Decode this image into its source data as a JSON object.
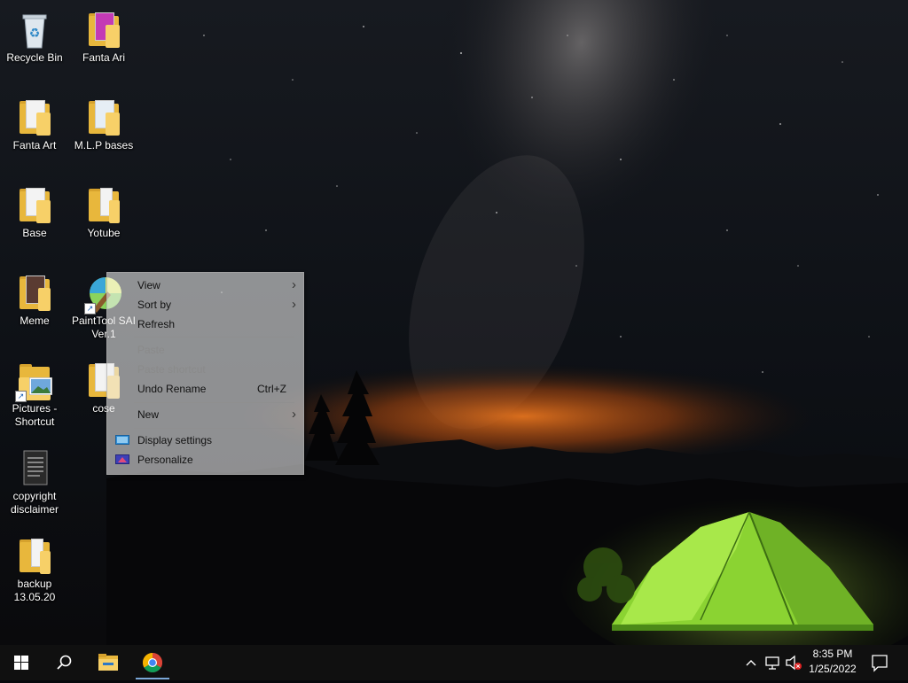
{
  "desktop": {
    "icons": [
      {
        "label": "Recycle Bin"
      },
      {
        "label": "Fanta Ari"
      },
      {
        "label": "Fanta Art"
      },
      {
        "label": "M.L.P bases"
      },
      {
        "label": "Base"
      },
      {
        "label": "Yotube"
      },
      {
        "label": "Meme"
      },
      {
        "label": "PaintTool SAI Ver.1"
      },
      {
        "label": "Pictures - Shortcut"
      },
      {
        "label": "cose"
      },
      {
        "label": "copyright disclaimer"
      },
      {
        "label": "backup 13.05.20"
      }
    ]
  },
  "context_menu": {
    "view": "View",
    "sort_by": "Sort by",
    "refresh": "Refresh",
    "paste": "Paste",
    "paste_shortcut": "Paste shortcut",
    "undo_rename": "Undo Rename",
    "undo_rename_shortcut": "Ctrl+Z",
    "new": "New",
    "display_settings": "Display settings",
    "personalize": "Personalize"
  },
  "taskbar": {
    "start_icon": "windows-logo-icon",
    "search_icon": "search-icon",
    "pinned": [
      "file-explorer-icon",
      "chrome-icon"
    ],
    "tray": {
      "time": "8:35 PM",
      "date": "1/25/2022",
      "icons": [
        "chevron-up-icon",
        "network-icon",
        "volume-muted-icon",
        "notification-icon"
      ]
    }
  },
  "colors": {
    "taskbar": "#101010",
    "folder": "#f7d068",
    "tent": "#9be03a",
    "sunset": "#d8621a"
  }
}
